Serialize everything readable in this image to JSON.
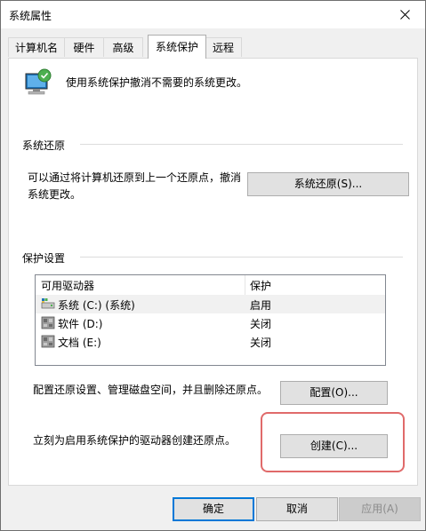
{
  "window": {
    "title": "系统属性"
  },
  "tabs": [
    {
      "label": "计算机名",
      "active": false
    },
    {
      "label": "硬件",
      "active": false
    },
    {
      "label": "高级",
      "active": false
    },
    {
      "label": "系统保护",
      "active": true
    },
    {
      "label": "远程",
      "active": false
    }
  ],
  "intro": {
    "text": "使用系统保护撤消不需要的系统更改。",
    "icon": "computer-protection-icon"
  },
  "restore": {
    "group_label": "系统还原",
    "description_line1": "可以通过将计算机还原到上一个还原点，撤消",
    "description_line2": "系统更改。",
    "button_label": "系统还原(S)..."
  },
  "protection": {
    "group_label": "保护设置",
    "columns": [
      "可用驱动器",
      "保护"
    ],
    "drives": [
      {
        "name": "系统 (C:) (系统)",
        "status": "启用",
        "icon": "system-drive-icon",
        "selected": true
      },
      {
        "name": "软件 (D:)",
        "status": "关闭",
        "icon": "disk-drive-icon",
        "selected": false
      },
      {
        "name": "文档 (E:)",
        "status": "关闭",
        "icon": "disk-drive-icon",
        "selected": false
      }
    ],
    "configure_text": "配置还原设置、管理磁盘空间，并且删除还原点。",
    "configure_button": "配置(O)...",
    "create_text": "立刻为启用系统保护的驱动器创建还原点。",
    "create_button": "创建(C)..."
  },
  "footer": {
    "ok": "确定",
    "cancel": "取消",
    "apply": "应用(A)"
  },
  "colors": {
    "accent": "#0078d7",
    "highlight": "#e06a6a",
    "window_bg": "#f0f0f0"
  }
}
